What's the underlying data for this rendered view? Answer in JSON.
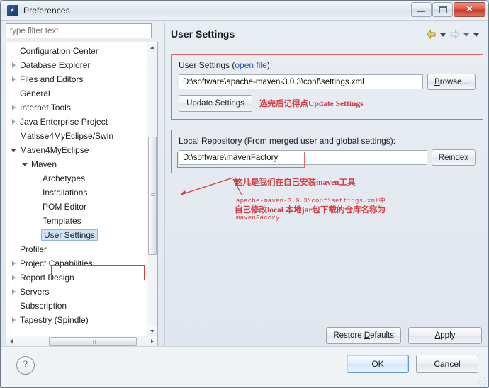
{
  "window": {
    "title": "Preferences",
    "icon": "eclipse-icon",
    "minimize": "minimize-icon",
    "maximize": "maximize-icon",
    "close": "✕"
  },
  "sidebar": {
    "filter_placeholder": "type filter text",
    "filter_value": "",
    "items": [
      {
        "label": "Configuration Center",
        "indent": 1,
        "arrow": "none",
        "selected": false
      },
      {
        "label": "Database Explorer",
        "indent": 1,
        "arrow": "collapsed",
        "selected": false
      },
      {
        "label": "Files and Editors",
        "indent": 1,
        "arrow": "collapsed",
        "selected": false
      },
      {
        "label": "General",
        "indent": 1,
        "arrow": "none",
        "selected": false
      },
      {
        "label": "Internet Tools",
        "indent": 1,
        "arrow": "collapsed",
        "selected": false
      },
      {
        "label": "Java Enterprise Project",
        "indent": 1,
        "arrow": "collapsed",
        "selected": false
      },
      {
        "label": "Matisse4MyEclipse/Swin",
        "indent": 1,
        "arrow": "none",
        "selected": false
      },
      {
        "label": "Maven4MyEclipse",
        "indent": 1,
        "arrow": "expanded",
        "selected": false
      },
      {
        "label": "Maven",
        "indent": 2,
        "arrow": "expanded",
        "selected": false
      },
      {
        "label": "Archetypes",
        "indent": 3,
        "arrow": "none",
        "selected": false
      },
      {
        "label": "Installations",
        "indent": 3,
        "arrow": "none",
        "selected": false
      },
      {
        "label": "POM Editor",
        "indent": 3,
        "arrow": "none",
        "selected": false
      },
      {
        "label": "Templates",
        "indent": 3,
        "arrow": "none",
        "selected": false
      },
      {
        "label": "User Settings",
        "indent": 3,
        "arrow": "none",
        "selected": true
      },
      {
        "label": "Profiler",
        "indent": 1,
        "arrow": "none",
        "selected": false
      },
      {
        "label": "Project Capabilities",
        "indent": 1,
        "arrow": "collapsed",
        "selected": false
      },
      {
        "label": "Report Design",
        "indent": 1,
        "arrow": "collapsed",
        "selected": false
      },
      {
        "label": "Servers",
        "indent": 1,
        "arrow": "collapsed",
        "selected": false
      },
      {
        "label": "Subscription",
        "indent": 1,
        "arrow": "none",
        "selected": false
      },
      {
        "label": "Tapestry (Spindle)",
        "indent": 1,
        "arrow": "collapsed",
        "selected": false
      }
    ]
  },
  "page": {
    "title": "User Settings",
    "nav": {
      "back": "back-arrow-icon",
      "back_menu": "chevron-down-icon",
      "forward": "forward-arrow-icon",
      "forward_menu": "chevron-down-icon",
      "view_menu": "chevron-down-icon"
    },
    "user_settings_group": {
      "label_before": "User ",
      "label_mnemonic": "S",
      "label_after": "ettings (",
      "link": "open file",
      "label_end": "):",
      "path_value": "D:\\software\\apache-maven-3.0.3\\conf\\settings.xml",
      "browse_label": "Browse...",
      "browse_mnemonic": "B",
      "update_label": "Update Settings"
    },
    "local_repo_group": {
      "label": "Local Repository (From merged user and global settings):",
      "path_value": "D:\\software\\mavenFactory",
      "reindex_label": "Reindex",
      "reindex_mnemonic": "n"
    },
    "restore_defaults_label": "Restore Defaults",
    "restore_mnemonic": "D",
    "apply_label": "Apply",
    "apply_mnemonic": "A"
  },
  "annotations": {
    "update_hint": "选完后记得点Update Settings",
    "repo_hint_line1": "这儿是我们在自己安装maven工具",
    "repo_hint_line2": "apache-maven-3.0.3\\conf\\settings.xml中",
    "repo_hint_line3": "自己修改local 本地jar包下载的仓库名称为",
    "repo_hint_line4": "mavenFacory",
    "color": "#d23b3f"
  },
  "footer": {
    "help": "?",
    "ok_label": "OK",
    "cancel_label": "Cancel"
  }
}
